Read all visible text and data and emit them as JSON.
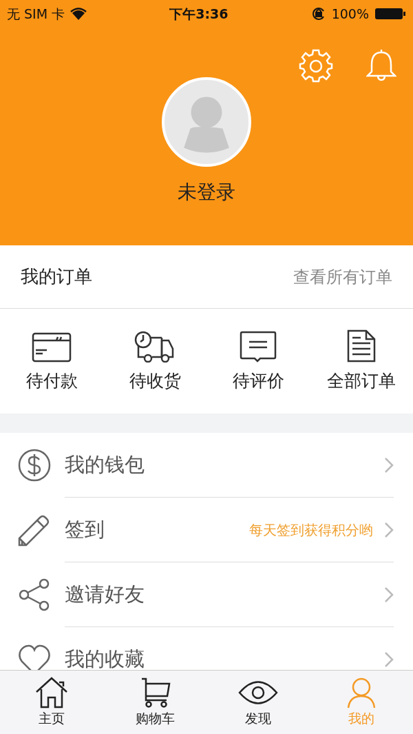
{
  "status_bar": {
    "carrier": "无 SIM 卡",
    "time": "下午3:36",
    "battery": "100%"
  },
  "profile": {
    "name": "未登录"
  },
  "orders": {
    "title": "我的订单",
    "view_all": "查看所有订单",
    "items": [
      {
        "kind": "card",
        "label": "待付款"
      },
      {
        "kind": "truck",
        "label": "待收货"
      },
      {
        "kind": "comment",
        "label": "待评价"
      },
      {
        "kind": "document",
        "label": "全部订单"
      }
    ]
  },
  "menu": [
    {
      "kind": "dollar",
      "label": "我的钱包"
    },
    {
      "kind": "pencil",
      "label": "签到",
      "hint": "每天签到获得积分哟"
    },
    {
      "kind": "share",
      "label": "邀请好友"
    },
    {
      "kind": "heart",
      "label": "我的收藏"
    }
  ],
  "tab_bar": [
    {
      "kind": "home",
      "label": "主页",
      "selected": false
    },
    {
      "kind": "cart",
      "label": "购物车",
      "selected": false
    },
    {
      "kind": "eye",
      "label": "发现",
      "selected": false
    },
    {
      "kind": "person",
      "label": "我的",
      "selected": true
    }
  ]
}
